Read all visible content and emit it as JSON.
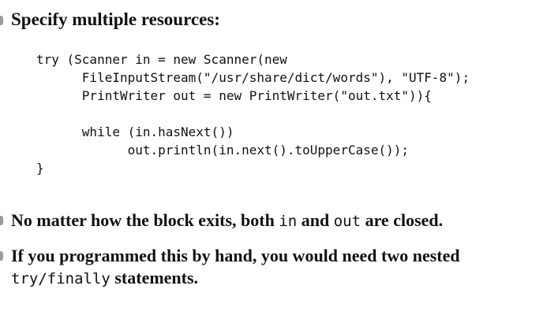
{
  "heading": "Specify multiple resources:",
  "code_lines": [
    "try (Scanner in = new Scanner(new",
    "      FileInputStream(\"/usr/share/dict/words\"), \"UTF-8\");",
    "      PrintWriter out = new PrintWriter(\"out.txt\")){",
    "",
    "      while (in.hasNext())",
    "            out.println(in.next().toUpperCase());",
    "}"
  ],
  "bullet1": {
    "text_a": "No matter how the block exits, both ",
    "code_a": "in",
    "text_b": " and ",
    "code_b": "out",
    "text_c": " are closed."
  },
  "bullet2": {
    "line1": "If you programmed this by hand, you would need two nested",
    "code_a": "try",
    "sep": "/",
    "code_b": "finally",
    "text_end": " statements."
  }
}
